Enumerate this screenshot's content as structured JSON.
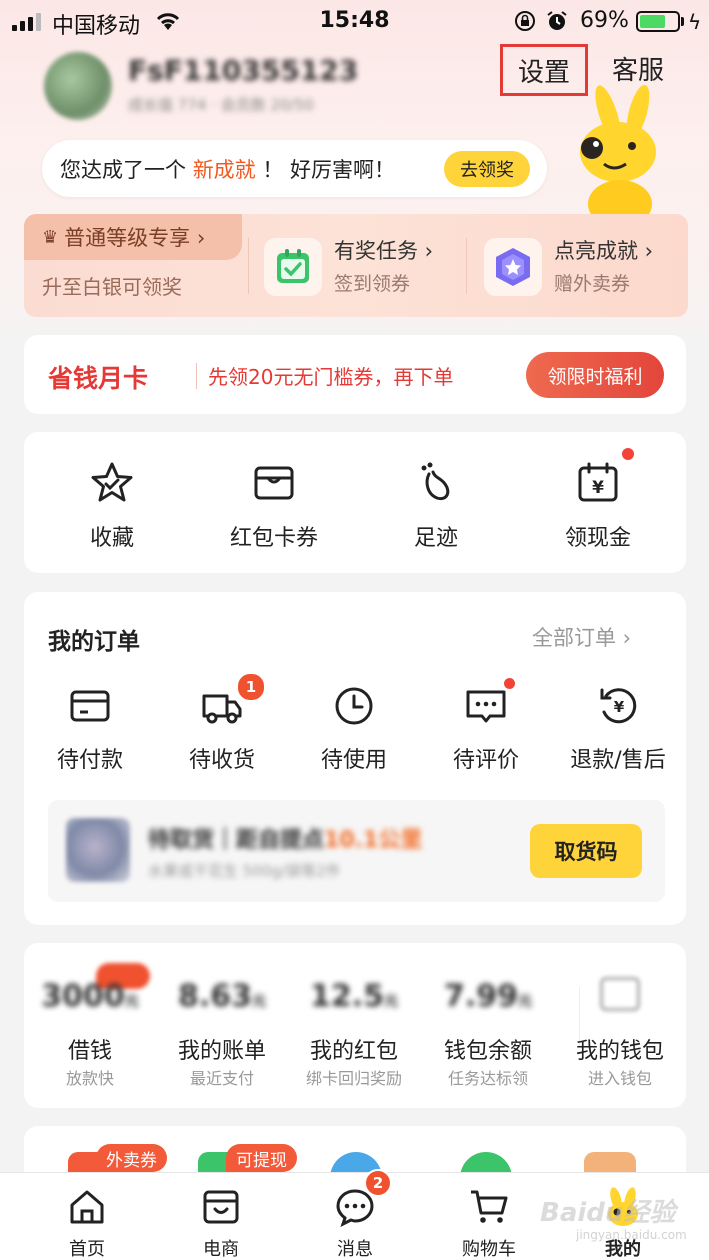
{
  "status_bar": {
    "carrier": "中国移动",
    "time": "15:48",
    "battery_percent": "69%",
    "battery_level": 0.69
  },
  "profile": {
    "username": "FsF110355123",
    "meta": "成长值 774 · 会员数 20/50",
    "settings_label": "设置",
    "service_label": "客服"
  },
  "achievement": {
    "text_before": "您达成了一个",
    "highlight": "新成就",
    "text_after": "！ 好厉害啊！",
    "button": "去领奖"
  },
  "level_panel": {
    "tag": "普通等级专享 ›",
    "tag_sub": "升至白银可领奖",
    "items": [
      {
        "title": "有奖任务 ›",
        "sub": "签到领券",
        "icon": "calendar-check-icon"
      },
      {
        "title": "点亮成就 ›",
        "sub": "赠外卖券",
        "icon": "badge-star-icon"
      }
    ]
  },
  "saver_card": {
    "title": "省钱月卡",
    "desc": "先领20元无门槛券，再下单",
    "button": "领限时福利"
  },
  "quick_items": [
    {
      "label": "收藏",
      "icon": "star-icon"
    },
    {
      "label": "红包卡券",
      "icon": "wallet-card-icon"
    },
    {
      "label": "足迹",
      "icon": "footprint-icon"
    },
    {
      "label": "领现金",
      "icon": "cash-calendar-icon"
    }
  ],
  "orders": {
    "title": "我的订单",
    "all_label": "全部订单 ›",
    "items": [
      {
        "label": "待付款",
        "icon": "card-icon"
      },
      {
        "label": "待收货",
        "icon": "truck-icon",
        "badge": "1"
      },
      {
        "label": "待使用",
        "icon": "clock-icon"
      },
      {
        "label": "待评价",
        "icon": "comment-icon"
      },
      {
        "label": "退款/售后",
        "icon": "refund-icon"
      }
    ],
    "pickup": {
      "title_prefix": "待取货｜距自提点",
      "title_distance": "10.1公里",
      "sub": "水果或干花生 500g/袋等2件",
      "button": "取货码"
    }
  },
  "wallet": {
    "items": [
      {
        "value": "3000",
        "unit": "元",
        "label": "借钱",
        "sub": "放款快"
      },
      {
        "value": "8.63",
        "unit": "元",
        "label": "我的账单",
        "sub": "最近支付"
      },
      {
        "value": "12.5",
        "unit": "元",
        "label": "我的红包",
        "sub": "绑卡回归奖励"
      },
      {
        "value": "7.99",
        "unit": "元",
        "label": "钱包余额",
        "sub": "任务达标领"
      },
      {
        "label": "我的钱包",
        "sub": "进入钱包"
      }
    ]
  },
  "service_strip": {
    "tags": [
      "外卖券",
      "可提现"
    ]
  },
  "tab_bar": {
    "items": [
      {
        "label": "首页",
        "icon": "home-icon"
      },
      {
        "label": "电商",
        "icon": "shop-box-icon"
      },
      {
        "label": "消息",
        "icon": "message-icon",
        "badge": "2"
      },
      {
        "label": "购物车",
        "icon": "cart-icon"
      },
      {
        "label": "我的",
        "icon": "mascot-icon",
        "active": true
      }
    ]
  },
  "watermark": {
    "text": "Baidu经验",
    "sub": "jingyan.baidu.com"
  },
  "colors": {
    "accent_red": "#e53935",
    "orange": "#f25a22",
    "yellow": "#ffd43a"
  }
}
